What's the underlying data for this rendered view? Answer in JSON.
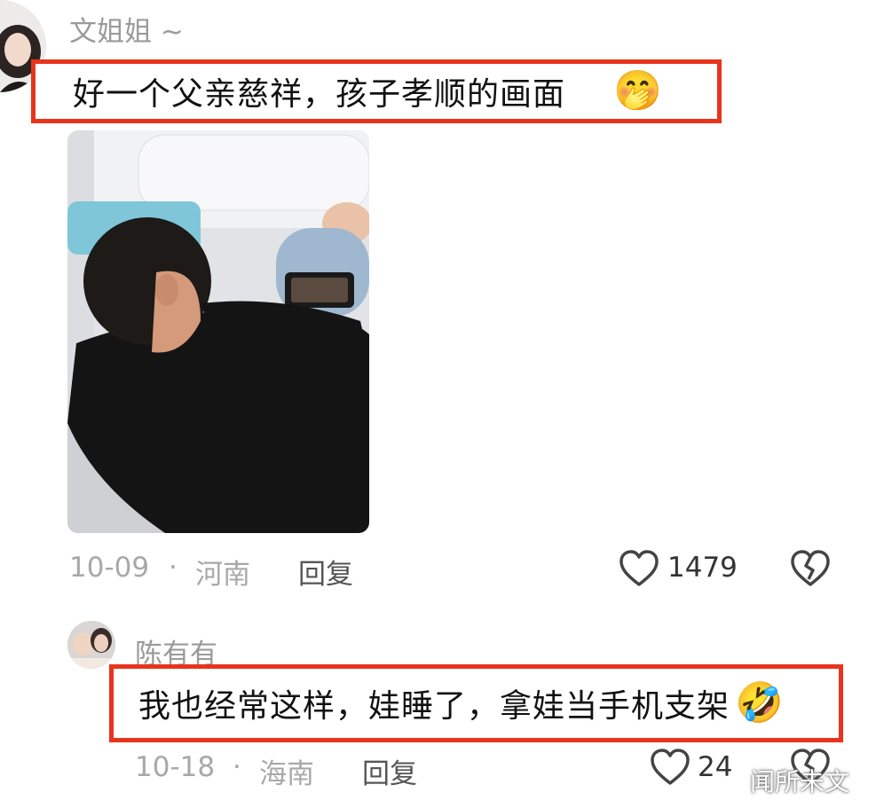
{
  "comments": [
    {
      "username": "文姐姐 ~",
      "text": "好一个父亲慈祥，孩子孝顺的画面",
      "emoji": "🤭",
      "date": "10-09",
      "dot": "·",
      "region": "河南",
      "reply_label": "回复",
      "likes": "1479"
    },
    {
      "username": "陈有有",
      "text": "我也经常这样，娃睡了，拿娃当手机支架",
      "emoji": "🤣",
      "date": "10-18",
      "dot": "·",
      "region": "海南",
      "reply_label": "回复",
      "likes": "24"
    }
  ],
  "watermark": "闻所未文",
  "colors": {
    "highlight_border": "#e8341c",
    "meta_gray": "#a8a8a8"
  },
  "icons": [
    "heart-icon",
    "broken-heart-icon"
  ]
}
